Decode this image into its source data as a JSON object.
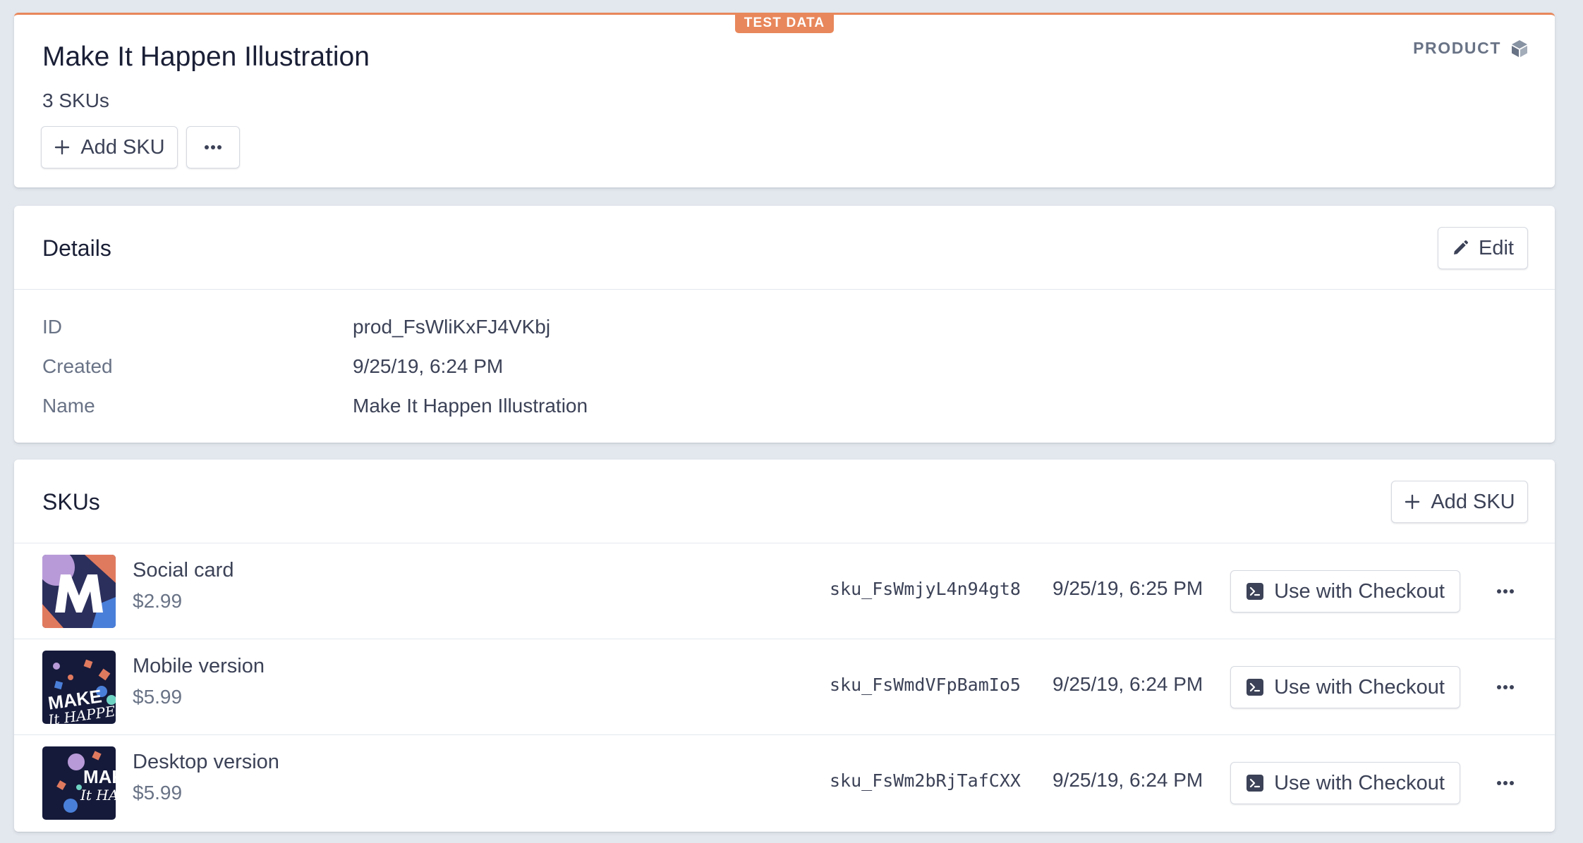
{
  "badge": "TEST DATA",
  "product": {
    "title": "Make It Happen Illustration",
    "sku_count": "3 SKUs",
    "type_label": "PRODUCT",
    "type_icon": "cube-icon",
    "add_sku_label": "Add SKU",
    "more_icon": "ellipsis-icon"
  },
  "details": {
    "title": "Details",
    "edit_label": "Edit",
    "edit_icon": "pencil-icon",
    "rows": [
      {
        "label": "ID",
        "value": "prod_FsWliKxFJ4VKbj"
      },
      {
        "label": "Created",
        "value": "9/25/19, 6:24 PM"
      },
      {
        "label": "Name",
        "value": "Make It Happen Illustration"
      }
    ]
  },
  "skus": {
    "title": "SKUs",
    "add_sku_label": "Add SKU",
    "items": [
      {
        "name": "Social card",
        "price": "$2.99",
        "id": "sku_FsWmjyL4n94gt8",
        "created": "9/25/19, 6:25 PM",
        "action": "Use with Checkout"
      },
      {
        "name": "Mobile version",
        "price": "$5.99",
        "id": "sku_FsWmdVFpBamIo5",
        "created": "9/25/19, 6:24 PM",
        "action": "Use with Checkout"
      },
      {
        "name": "Desktop version",
        "price": "$5.99",
        "id": "sku_FsWm2bRjTafCXX",
        "created": "9/25/19, 6:24 PM",
        "action": "Use with Checkout"
      }
    ]
  },
  "colors": {
    "test_badge": "#e8875b",
    "background": "#e3e8ee",
    "text_primary": "#1a1f36",
    "text_secondary": "#697386"
  }
}
